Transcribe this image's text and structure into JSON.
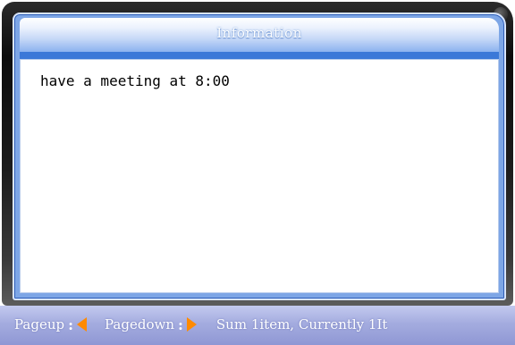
{
  "window": {
    "title": "Information"
  },
  "message": {
    "text": "have a meeting at 8:00"
  },
  "status_bar": {
    "pageup_label": "Pageup",
    "pagedown_label": "Pagedown",
    "separator": ":",
    "summary": "Sum 1item, Currently 1It"
  },
  "icons": {
    "pageup_icon": "triangle-left-icon",
    "pagedown_icon": "triangle-right-icon"
  },
  "colors": {
    "accent_blue": "#3b78d8",
    "arrow_orange": "#ff8a00",
    "status_bar_bg": "#a4acdf"
  }
}
